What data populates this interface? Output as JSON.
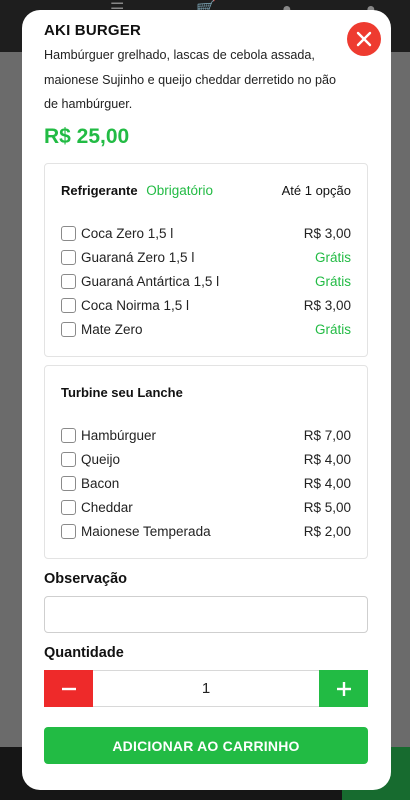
{
  "product": {
    "title": "AKI BURGER",
    "description": "Hambúrguer grelhado, lascas de cebola assada, maionese Sujinho e queijo cheddar derretido no pão de hambúrguer.",
    "price": "R$ 25,00"
  },
  "groups": [
    {
      "name": "Refrigerante",
      "tag": "Obrigatório",
      "limit": "Até 1 opção",
      "options": [
        {
          "label": "Coca Zero 1,5 l",
          "price": "R$ 3,00",
          "free": false
        },
        {
          "label": "Guaraná Zero 1,5 l",
          "price": "Grátis",
          "free": true
        },
        {
          "label": "Guaraná Antártica 1,5 l",
          "price": "Grátis",
          "free": true
        },
        {
          "label": "Coca Noirma 1,5 l",
          "price": "R$ 3,00",
          "free": false
        },
        {
          "label": "Mate Zero",
          "price": "Grátis",
          "free": true
        }
      ]
    },
    {
      "name": "Turbine seu Lanche",
      "tag": "",
      "limit": "",
      "options": [
        {
          "label": "Hambúrguer",
          "price": "R$ 7,00",
          "free": false
        },
        {
          "label": "Queijo",
          "price": "R$ 4,00",
          "free": false
        },
        {
          "label": "Bacon",
          "price": "R$ 4,00",
          "free": false
        },
        {
          "label": "Cheddar",
          "price": "R$ 5,00",
          "free": false
        },
        {
          "label": "Maionese Temperada",
          "price": "R$ 2,00",
          "free": false
        }
      ]
    }
  ],
  "observation": {
    "label": "Observação",
    "value": "",
    "placeholder": ""
  },
  "quantity": {
    "label": "Quantidade",
    "value": "1"
  },
  "add_button": "ADICIONAR AO CARRINHO",
  "icons": {
    "close": "close-icon",
    "minus": "minus-icon",
    "plus": "plus-icon"
  },
  "colors": {
    "accent_green": "#22bb44",
    "danger_red": "#ee2a2a",
    "close_red": "#ee3b30"
  }
}
